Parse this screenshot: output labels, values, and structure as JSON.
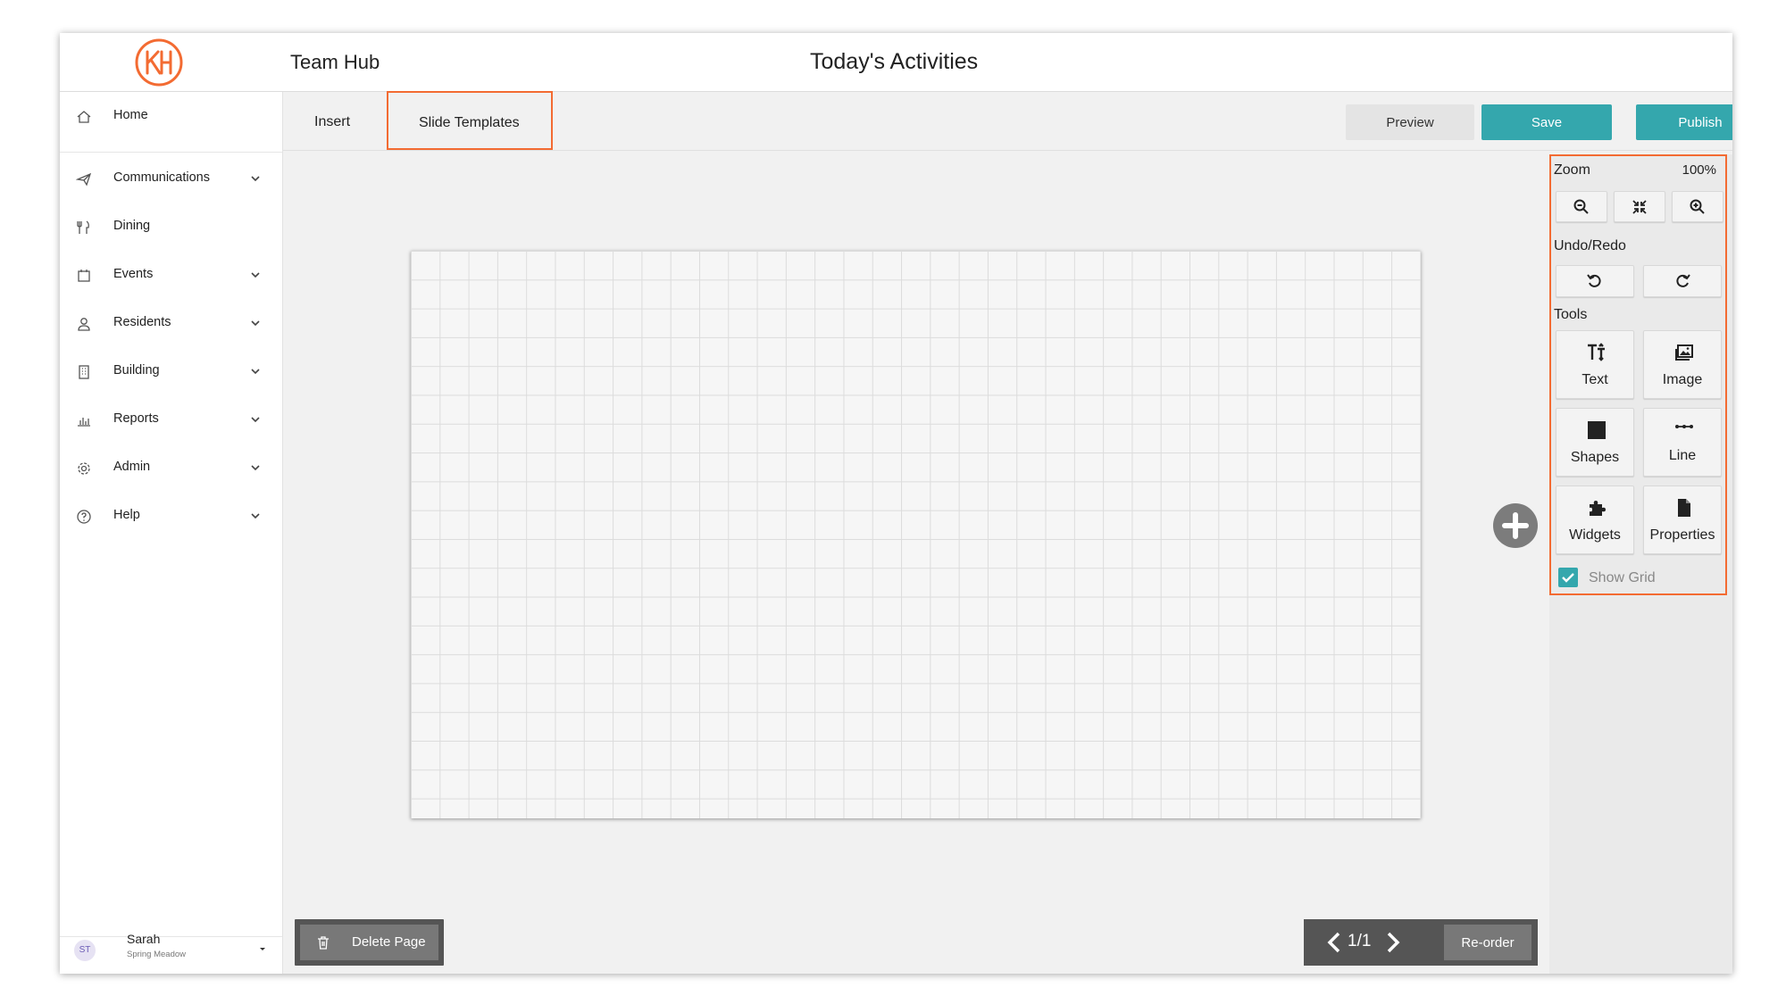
{
  "header": {
    "org_name": "Team Hub",
    "page_title": "Today's Activities",
    "logo_icon": "kh-logo-icon"
  },
  "sidebar": {
    "items": [
      {
        "label": "Home",
        "icon": "home-icon",
        "expandable": false
      },
      {
        "label": "Communications",
        "icon": "paper-plane-icon",
        "expandable": true
      },
      {
        "label": "Dining",
        "icon": "utensils-icon",
        "expandable": false
      },
      {
        "label": "Events",
        "icon": "calendar-icon",
        "expandable": true
      },
      {
        "label": "Residents",
        "icon": "user-icon",
        "expandable": true
      },
      {
        "label": "Building",
        "icon": "building-icon",
        "expandable": true
      },
      {
        "label": "Reports",
        "icon": "bar-chart-icon",
        "expandable": true
      },
      {
        "label": "Admin",
        "icon": "gear-icon",
        "expandable": true
      },
      {
        "label": "Help",
        "icon": "help-circle-icon",
        "expandable": true
      }
    ],
    "user": {
      "initials": "ST",
      "name": "Sarah",
      "community": "Spring Meadow"
    }
  },
  "toolbar": {
    "tabs": [
      {
        "label": "Insert"
      },
      {
        "label": "Slide Templates"
      }
    ],
    "preview_label": "Preview",
    "save_label": "Save",
    "publish_label": "Publish"
  },
  "tools_panel": {
    "zoom_label": "Zoom",
    "zoom_value": "100%",
    "undo_redo_label": "Undo/Redo",
    "tools_label": "Tools",
    "tools": [
      {
        "label": "Text",
        "icon": "text-size-icon"
      },
      {
        "label": "Image",
        "icon": "image-icon"
      },
      {
        "label": "Shapes",
        "icon": "square-icon"
      },
      {
        "label": "Line",
        "icon": "line-icon"
      },
      {
        "label": "Widgets",
        "icon": "puzzle-icon"
      },
      {
        "label": "Properties",
        "icon": "document-icon"
      }
    ],
    "show_grid_label": "Show Grid",
    "show_grid_checked": true
  },
  "footer": {
    "delete_label": "Delete Page",
    "page_count": "1/1",
    "reorder_label": "Re-order"
  },
  "colors": {
    "accent": "#34a7ad",
    "highlight": "#f36b32",
    "logo": "#f36b32"
  }
}
